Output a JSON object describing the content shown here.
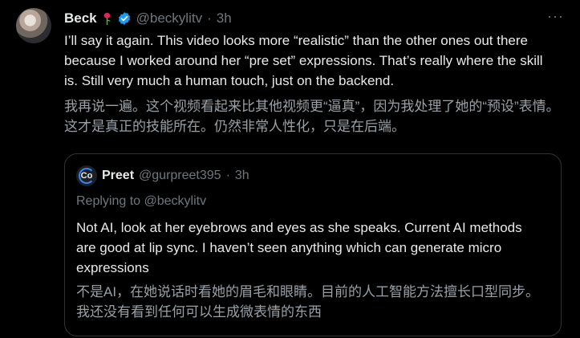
{
  "post": {
    "name": "Beck",
    "handle": "@beckylitv",
    "separator": "·",
    "time": "3h",
    "more_label": "···",
    "text_en": "I’ll say it again. This video looks more “realistic” than the other ones out there because I worked around her “pre set” expressions. That’s really where the skill is. Still very much a human touch, just on the backend.",
    "text_zh": "我再说一遍。这个视频看起来比其他视频更“逼真”，因为我处理了她的“预设”表情。这才是真正的技能所在。仍然非常人性化，只是在后端。"
  },
  "quote": {
    "avatar_text": "Co",
    "name": "Preet",
    "handle": "@gurpreet395",
    "separator": "·",
    "time": "3h",
    "replying_to": "Replying to @beckylitv",
    "text_en": "Not AI, look at her eyebrows and eyes as she speaks. Current AI methods are good at lip sync. I haven’t seen anything which can generate micro expressions",
    "text_zh": "不是AI，在她说话时看她的眉毛和眼睛。目前的人工智能方法擅长口型同步。我还没有看到任何可以生成微表情的东西"
  },
  "colors": {
    "background": "#000000",
    "text": "#e7e9ea",
    "muted": "#71767b",
    "verified": "#1d9bf0",
    "rose": "#e0245e"
  },
  "icons": [
    "rose-icon",
    "verified-badge-icon",
    "more-options-icon"
  ]
}
